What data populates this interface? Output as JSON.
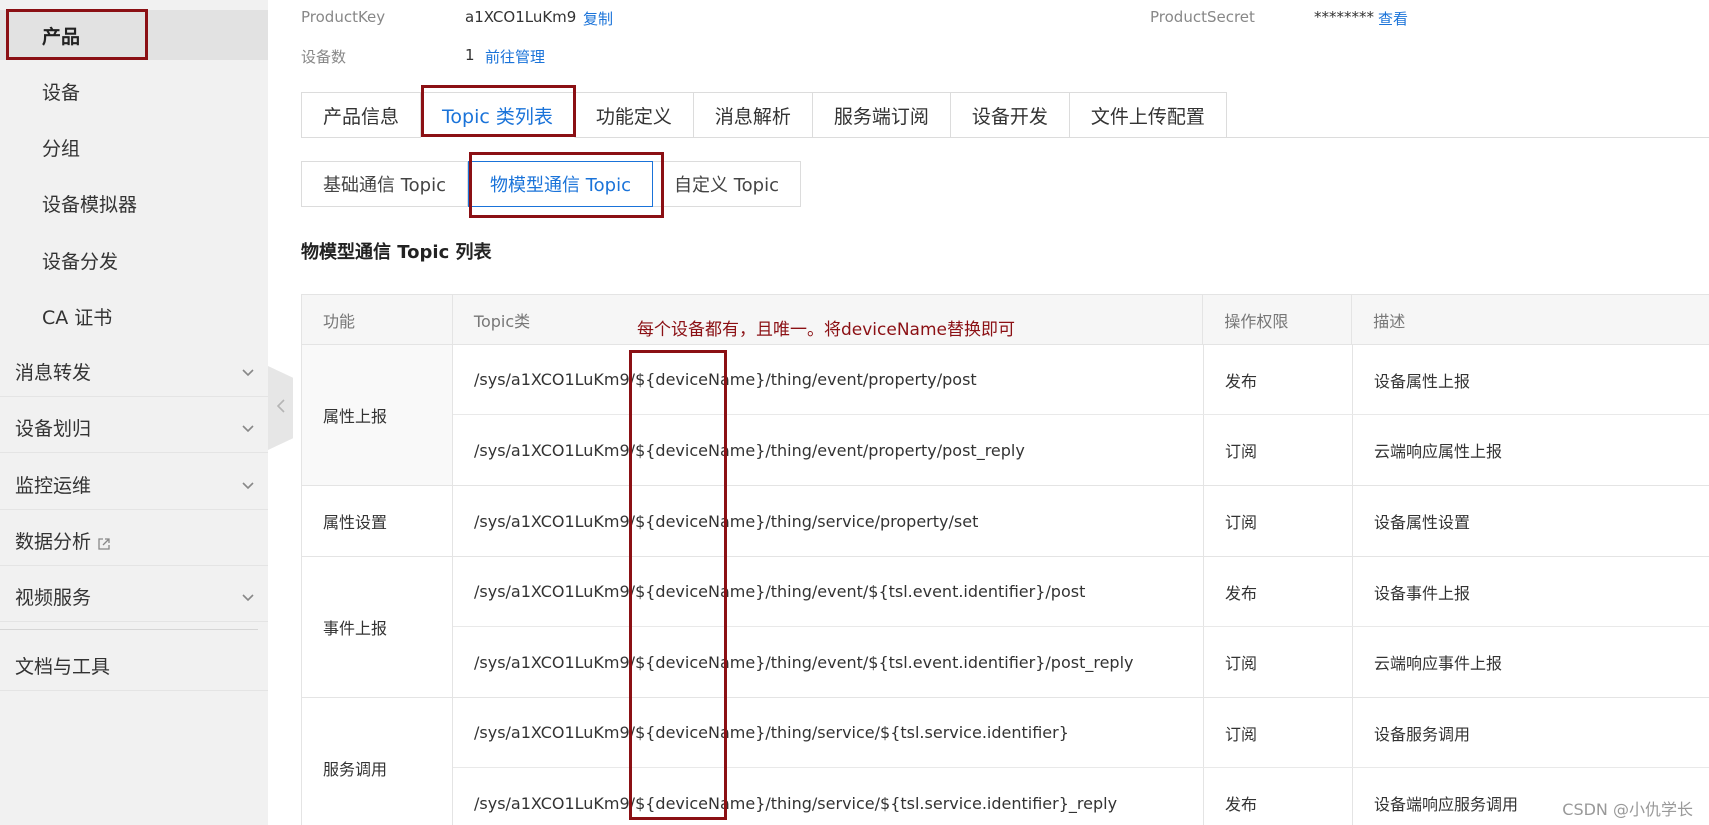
{
  "sidebar": {
    "items": [
      {
        "label": "产品"
      },
      {
        "label": "设备"
      },
      {
        "label": "分组"
      },
      {
        "label": "设备模拟器"
      },
      {
        "label": "设备分发"
      },
      {
        "label": "CA 证书"
      }
    ],
    "groups": [
      {
        "label": "消息转发"
      },
      {
        "label": "设备划归"
      },
      {
        "label": "监控运维"
      },
      {
        "label": "数据分析"
      },
      {
        "label": "视频服务"
      }
    ],
    "docs_label": "文档与工具"
  },
  "header": {
    "product_key_label": "ProductKey",
    "product_key_value": "a1XCO1LuKm9",
    "copy_link": "复制",
    "product_secret_label": "ProductSecret",
    "product_secret_value": "********",
    "view_link": "查看",
    "device_count_label": "设备数",
    "device_count_value": "1",
    "manage_link": "前往管理"
  },
  "tabs": [
    {
      "label": "产品信息"
    },
    {
      "label": "Topic 类列表"
    },
    {
      "label": "功能定义"
    },
    {
      "label": "消息解析"
    },
    {
      "label": "服务端订阅"
    },
    {
      "label": "设备开发"
    },
    {
      "label": "文件上传配置"
    }
  ],
  "active_tab": "Topic 类列表",
  "subtabs": [
    {
      "label": "基础通信 Topic"
    },
    {
      "label": "物模型通信 Topic"
    },
    {
      "label": "自定义 Topic"
    }
  ],
  "active_subtab": "物模型通信 Topic",
  "section_title": "物模型通信 Topic 列表",
  "table": {
    "headers": [
      "功能",
      "Topic类",
      "操作权限",
      "描述"
    ],
    "groups": [
      {
        "function": "属性上报",
        "rows": [
          {
            "topic": "/sys/a1XCO1LuKm9/${deviceName}/thing/event/property/post",
            "permission": "发布",
            "description": "设备属性上报"
          },
          {
            "topic": "/sys/a1XCO1LuKm9/${deviceName}/thing/event/property/post_reply",
            "permission": "订阅",
            "description": "云端响应属性上报"
          }
        ]
      },
      {
        "function": "属性设置",
        "rows": [
          {
            "topic": "/sys/a1XCO1LuKm9/${deviceName}/thing/service/property/set",
            "permission": "订阅",
            "description": "设备属性设置"
          }
        ]
      },
      {
        "function": "事件上报",
        "rows": [
          {
            "topic": "/sys/a1XCO1LuKm9/${deviceName}/thing/event/${tsl.event.identifier}/post",
            "permission": "发布",
            "description": "设备事件上报"
          },
          {
            "topic": "/sys/a1XCO1LuKm9/${deviceName}/thing/event/${tsl.event.identifier}/post_reply",
            "permission": "订阅",
            "description": "云端响应事件上报"
          }
        ]
      },
      {
        "function": "服务调用",
        "rows": [
          {
            "topic": "/sys/a1XCO1LuKm9/${deviceName}/thing/service/${tsl.service.identifier}",
            "permission": "订阅",
            "description": "设备服务调用"
          },
          {
            "topic": "/sys/a1XCO1LuKm9/${deviceName}/thing/service/${tsl.service.identifier}_reply",
            "permission": "发布",
            "description": "设备端响应服务调用"
          }
        ]
      }
    ]
  },
  "annotation": "每个设备都有，且唯一。将deviceName替换即可",
  "watermark": "CSDN @小仇学长",
  "colors": {
    "link": "#1a73d9",
    "annotation_red": "#8b1014",
    "sidebar_bg": "#f1f1f1"
  },
  "icons": {
    "group_toggle": "chevron-down-icon",
    "external": "external-link-icon",
    "collapse": "chevron-left-icon"
  }
}
